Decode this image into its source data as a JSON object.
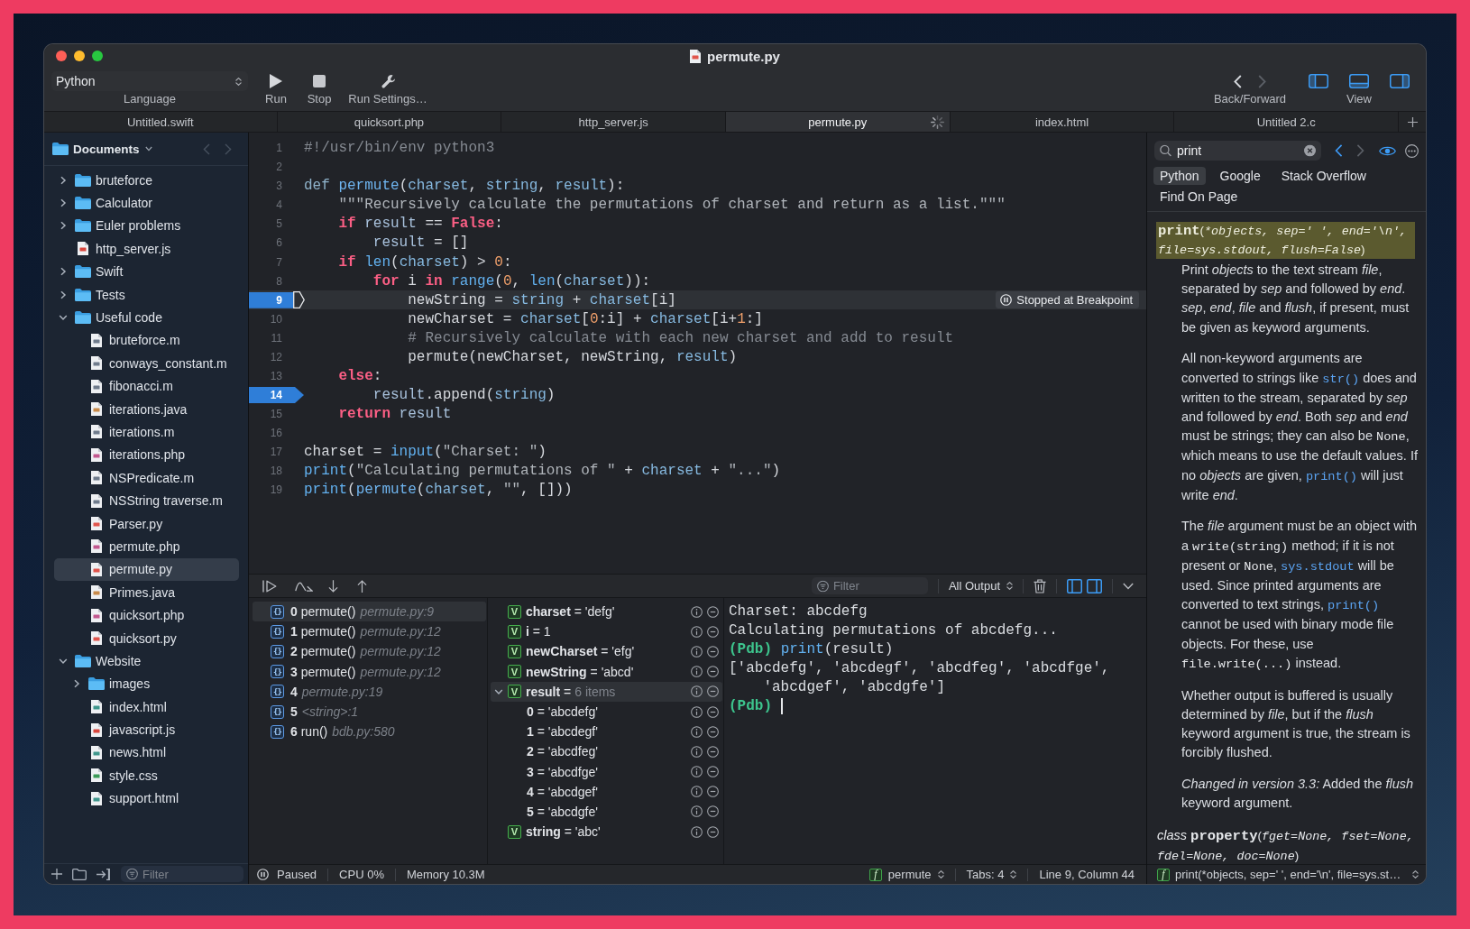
{
  "window": {
    "title": "permute.py",
    "kind": "py"
  },
  "toolbar": {
    "language": {
      "value": "Python",
      "label": "Language"
    },
    "actions": [
      {
        "kind": "run",
        "label": "Run"
      },
      {
        "kind": "stop",
        "label": "Stop"
      },
      {
        "kind": "settings",
        "label": "Run Settings…"
      }
    ],
    "navigation": {
      "label": "Back/Forward",
      "back_enabled": true,
      "forward_enabled": false
    },
    "view": {
      "label": "View",
      "toggles": [
        {
          "on": true
        },
        {
          "on": true
        },
        {
          "on": true
        }
      ]
    }
  },
  "tabs": [
    {
      "label": "Untitled.swift",
      "selected": false,
      "busy": false
    },
    {
      "label": "quicksort.php",
      "selected": false,
      "busy": false
    },
    {
      "label": "http_server.js",
      "selected": false,
      "busy": false
    },
    {
      "label": "permute.py",
      "selected": true,
      "busy": true
    },
    {
      "label": "index.html",
      "selected": false,
      "busy": false
    },
    {
      "label": "Untitled 2.c",
      "selected": false,
      "busy": false
    }
  ],
  "sidebar": {
    "title": "Documents",
    "back_enabled": false,
    "forward_enabled": false,
    "items": [
      {
        "kind": "folder",
        "name": "bruteforce",
        "expanded": false,
        "selected": false
      },
      {
        "kind": "folder",
        "name": "Calculator",
        "expanded": false,
        "selected": false
      },
      {
        "kind": "folder",
        "name": "Euler problems",
        "expanded": false,
        "selected": false
      },
      {
        "kind": "js",
        "name": "http_server.js",
        "selected": false
      },
      {
        "kind": "folder",
        "name": "Swift",
        "expanded": false,
        "selected": false
      },
      {
        "kind": "folder",
        "name": "Tests",
        "expanded": false,
        "selected": false
      },
      {
        "kind": "folder",
        "name": "Useful code",
        "expanded": true,
        "selected": false,
        "children": [
          {
            "kind": "m",
            "name": "bruteforce.m",
            "selected": false
          },
          {
            "kind": "m",
            "name": "conways_constant.m",
            "selected": false
          },
          {
            "kind": "m",
            "name": "fibonacci.m",
            "selected": false
          },
          {
            "kind": "java",
            "name": "iterations.java",
            "selected": false
          },
          {
            "kind": "m",
            "name": "iterations.m",
            "selected": false
          },
          {
            "kind": "php",
            "name": "iterations.php",
            "selected": false
          },
          {
            "kind": "m",
            "name": "NSPredicate.m",
            "selected": false
          },
          {
            "kind": "m",
            "name": "NSString traverse.m",
            "selected": false
          },
          {
            "kind": "py",
            "name": "Parser.py",
            "selected": false
          },
          {
            "kind": "php",
            "name": "permute.php",
            "selected": false
          },
          {
            "kind": "py",
            "name": "permute.py",
            "selected": true
          },
          {
            "kind": "java",
            "name": "Primes.java",
            "selected": false
          },
          {
            "kind": "php",
            "name": "quicksort.php",
            "selected": false
          },
          {
            "kind": "py",
            "name": "quicksort.py",
            "selected": false
          }
        ]
      },
      {
        "kind": "folder",
        "name": "Website",
        "expanded": true,
        "selected": false,
        "children": [
          {
            "kind": "folder",
            "name": "images",
            "expanded": false,
            "selected": false
          },
          {
            "kind": "html",
            "name": "index.html",
            "selected": false
          },
          {
            "kind": "js",
            "name": "javascript.js",
            "selected": false
          },
          {
            "kind": "html",
            "name": "news.html",
            "selected": false
          },
          {
            "kind": "css",
            "name": "style.css",
            "selected": false
          },
          {
            "kind": "html",
            "name": "support.html",
            "selected": false
          }
        ]
      }
    ],
    "filter": {
      "placeholder": "Filter"
    }
  },
  "editor": {
    "lines": [
      {
        "number": "1",
        "breakpoint": false,
        "current": false,
        "tokens": [
          {
            "kind": "comment",
            "text": "#!/usr/bin/env python3"
          }
        ]
      },
      {
        "number": "2",
        "breakpoint": false,
        "current": false
      },
      {
        "number": "3",
        "breakpoint": false,
        "current": false,
        "tokens": [
          {
            "kind": "decl",
            "text": "def "
          },
          {
            "kind": "name",
            "text": "permute"
          },
          {
            "kind": "plain",
            "text": "("
          },
          {
            "kind": "var",
            "text": "charset"
          },
          {
            "kind": "plain",
            "text": ", "
          },
          {
            "kind": "var",
            "text": "string"
          },
          {
            "kind": "plain",
            "text": ", "
          },
          {
            "kind": "var",
            "text": "result"
          },
          {
            "kind": "plain",
            "text": "):"
          }
        ]
      },
      {
        "number": "4",
        "breakpoint": false,
        "current": false,
        "tokens": [
          {
            "kind": "string",
            "text": "    \"\"\"Recursively calculate the permutations of charset and return as a list.\"\"\""
          }
        ]
      },
      {
        "number": "5",
        "breakpoint": false,
        "current": false,
        "tokens": [
          {
            "kind": "keyword",
            "text": "    if"
          },
          {
            "kind": "ident",
            "text": " result"
          },
          {
            "kind": "plain",
            "text": " == "
          },
          {
            "kind": "keyword",
            "text": "False"
          },
          {
            "kind": "plain",
            "text": ":"
          }
        ]
      },
      {
        "number": "6",
        "breakpoint": false,
        "current": false,
        "tokens": [
          {
            "kind": "ident",
            "text": "        result"
          },
          {
            "kind": "plain",
            "text": " = []"
          }
        ]
      },
      {
        "number": "7",
        "breakpoint": false,
        "current": false,
        "tokens": [
          {
            "kind": "keyword",
            "text": "    if "
          },
          {
            "kind": "builtin",
            "text": "len"
          },
          {
            "kind": "plain",
            "text": "("
          },
          {
            "kind": "var",
            "text": "charset"
          },
          {
            "kind": "plain",
            "text": ") > "
          },
          {
            "kind": "number",
            "text": "0"
          },
          {
            "kind": "plain",
            "text": ":"
          }
        ]
      },
      {
        "number": "8",
        "breakpoint": false,
        "current": false,
        "tokens": [
          {
            "kind": "keyword",
            "text": "        for"
          },
          {
            "kind": "plain",
            "text": " i "
          },
          {
            "kind": "keyword",
            "text": "in "
          },
          {
            "kind": "builtin",
            "text": "range"
          },
          {
            "kind": "plain",
            "text": "("
          },
          {
            "kind": "number",
            "text": "0"
          },
          {
            "kind": "plain",
            "text": ", "
          },
          {
            "kind": "builtin",
            "text": "len"
          },
          {
            "kind": "plain",
            "text": "("
          },
          {
            "kind": "var",
            "text": "charset"
          },
          {
            "kind": "plain",
            "text": ")):"
          }
        ]
      },
      {
        "number": "9",
        "breakpoint": true,
        "current": true,
        "badge": "Stopped at Breakpoint",
        "tokens": [
          {
            "kind": "plain",
            "text": "            newString = "
          },
          {
            "kind": "var",
            "text": "string"
          },
          {
            "kind": "plain",
            "text": " + "
          },
          {
            "kind": "var",
            "text": "charset"
          },
          {
            "kind": "plain",
            "text": "[i]"
          }
        ]
      },
      {
        "number": "10",
        "breakpoint": false,
        "current": false,
        "tokens": [
          {
            "kind": "plain",
            "text": "            newCharset = "
          },
          {
            "kind": "var",
            "text": "charset"
          },
          {
            "kind": "plain",
            "text": "["
          },
          {
            "kind": "number",
            "text": "0"
          },
          {
            "kind": "plain",
            "text": ":i] + "
          },
          {
            "kind": "var",
            "text": "charset"
          },
          {
            "kind": "plain",
            "text": "[i+"
          },
          {
            "kind": "number",
            "text": "1"
          },
          {
            "kind": "plain",
            "text": ":]"
          }
        ]
      },
      {
        "number": "11",
        "breakpoint": false,
        "current": false,
        "tokens": [
          {
            "kind": "comment",
            "text": "            # Recursively calculate with each new charset and add to result"
          }
        ]
      },
      {
        "number": "12",
        "breakpoint": false,
        "current": false,
        "tokens": [
          {
            "kind": "plain",
            "text": "            permute(newCharset, newString, "
          },
          {
            "kind": "var",
            "text": "result"
          },
          {
            "kind": "plain",
            "text": ")"
          }
        ]
      },
      {
        "number": "13",
        "breakpoint": false,
        "current": false,
        "tokens": [
          {
            "kind": "keyword",
            "text": "    else"
          },
          {
            "kind": "plain",
            "text": ":"
          }
        ]
      },
      {
        "number": "14",
        "breakpoint": true,
        "current": false,
        "tokens": [
          {
            "kind": "ident",
            "text": "        result"
          },
          {
            "kind": "plain",
            "text": ".append("
          },
          {
            "kind": "var",
            "text": "string"
          },
          {
            "kind": "plain",
            "text": ")"
          }
        ]
      },
      {
        "number": "15",
        "breakpoint": false,
        "current": false,
        "tokens": [
          {
            "kind": "keyword",
            "text": "    return"
          },
          {
            "kind": "ident",
            "text": " result"
          }
        ]
      },
      {
        "number": "16",
        "breakpoint": false,
        "current": false
      },
      {
        "number": "17",
        "breakpoint": false,
        "current": false,
        "tokens": [
          {
            "kind": "plain",
            "text": "charset = "
          },
          {
            "kind": "builtin",
            "text": "input"
          },
          {
            "kind": "plain",
            "text": "("
          },
          {
            "kind": "string",
            "text": "\"Charset: \""
          },
          {
            "kind": "plain",
            "text": ")"
          }
        ]
      },
      {
        "number": "18",
        "breakpoint": false,
        "current": false,
        "tokens": [
          {
            "kind": "builtin",
            "text": "print"
          },
          {
            "kind": "plain",
            "text": "("
          },
          {
            "kind": "string",
            "text": "\"Calculating permutations of \""
          },
          {
            "kind": "plain",
            "text": " + "
          },
          {
            "kind": "var",
            "text": "charset"
          },
          {
            "kind": "plain",
            "text": " + "
          },
          {
            "kind": "string",
            "text": "\"...\""
          },
          {
            "kind": "plain",
            "text": ")"
          }
        ]
      },
      {
        "number": "19",
        "breakpoint": false,
        "current": false,
        "tokens": [
          {
            "kind": "builtin",
            "text": "print"
          },
          {
            "kind": "plain",
            "text": "("
          },
          {
            "kind": "name",
            "text": "permute"
          },
          {
            "kind": "plain",
            "text": "("
          },
          {
            "kind": "var",
            "text": "charset"
          },
          {
            "kind": "plain",
            "text": ", "
          },
          {
            "kind": "string",
            "text": "\"\""
          },
          {
            "kind": "plain",
            "text": ", []))"
          }
        ]
      }
    ]
  },
  "debugger": {
    "filter": {
      "placeholder": "Filter"
    },
    "output_selector": "All Output",
    "pane_toggles": [
      {
        "on": true
      },
      {
        "on": true
      }
    ],
    "stack": [
      {
        "icon": "{}",
        "label": "**0** permute()",
        "location": "permute.py:9",
        "selected": true
      },
      {
        "icon": "{}",
        "label": "**1** permute()",
        "location": "permute.py:12",
        "selected": false
      },
      {
        "icon": "{}",
        "label": "**2** permute()",
        "location": "permute.py:12",
        "selected": false
      },
      {
        "icon": "{}",
        "label": "**3** permute()",
        "location": "permute.py:12",
        "selected": false
      },
      {
        "icon": "{}",
        "label": "**4**",
        "location": "permute.py:19",
        "selected": false
      },
      {
        "icon": "{}",
        "label": "**5**",
        "location": "<string>:1",
        "selected": false
      },
      {
        "icon": "{}",
        "label": "**6** run()",
        "location": "bdb.py:580",
        "selected": false
      }
    ],
    "variables": [
      {
        "icon": "V",
        "label": "**charset** = 'defg'",
        "selected": false
      },
      {
        "icon": "V",
        "label": "**i** = 1",
        "selected": false
      },
      {
        "icon": "V",
        "label": "**newCharset** = 'efg'",
        "selected": false
      },
      {
        "icon": "V",
        "label": "**newString** = 'abcd'",
        "selected": false
      },
      {
        "icon": "V",
        "label": "**result** =",
        "summary": "6 items",
        "expanded": true,
        "selected": true,
        "children": [
          {
            "label": "**0** = 'abcdefg'",
            "selected": false
          },
          {
            "label": "**1** = 'abcdegf'",
            "selected": false
          },
          {
            "label": "**2** = 'abcdfeg'",
            "selected": false
          },
          {
            "label": "**3** = 'abcdfge'",
            "selected": false
          },
          {
            "label": "**4** = 'abcdgef'",
            "selected": false
          },
          {
            "label": "**5** = 'abcdgfe'",
            "selected": false
          }
        ]
      },
      {
        "icon": "V",
        "label": "**string** = 'abc'",
        "selected": false
      }
    ],
    "console": [
      {
        "kind": "output",
        "text": "Charset: abcdefg"
      },
      {
        "kind": "output",
        "text": "Calculating permutations of abcdefg..."
      },
      {
        "kind": "prompt",
        "prompt": "(Pdb)",
        "tokens": [
          {
            "kind": "builtin",
            "text": "print"
          },
          {
            "kind": "plain",
            "text": "(result)"
          }
        ],
        "cursor": false
      },
      {
        "kind": "output",
        "text": "['abcdefg', 'abcdegf', 'abcdfeg', 'abcdfge', 'abcdgef', 'abcdgfe']"
      },
      {
        "kind": "prompt",
        "prompt": "(Pdb)",
        "cursor": true
      }
    ]
  },
  "status_bar": {
    "state": "Paused",
    "cpu": "CPU 0%",
    "memory": "Memory 10.3M",
    "function": {
      "icon": "f",
      "label": "permute"
    },
    "tabs": "Tabs: 4",
    "position": "Line 9, Column 44"
  },
  "docs": {
    "search": {
      "value": "print"
    },
    "back_enabled": true,
    "forward_enabled": false,
    "preview_on": true,
    "sources": [
      {
        "label": "Python",
        "selected": true
      },
      {
        "label": "Google",
        "selected": false
      },
      {
        "label": "Stack Overflow",
        "selected": false
      },
      {
        "label": "Find On Page",
        "selected": false
      }
    ],
    "signature": [
      {
        "kind": "name",
        "text": "print"
      },
      {
        "kind": "punct",
        "text": "("
      },
      {
        "kind": "params",
        "text": "*objects, sep=' ', end='\\n', file=sys.stdout, flush=False"
      },
      {
        "kind": "punct",
        "text": ")"
      }
    ],
    "paragraphs": [
      {
        "parts": [
          {
            "kind": "text",
            "text": "Print *objects* to the text stream *file*, separated by *sep* and followed by *end*. *sep*, *end*, *file* and *flush*, if present, must be given as keyword arguments."
          }
        ]
      },
      {
        "parts": [
          {
            "kind": "text",
            "text": "All non-keyword arguments are converted to strings like "
          },
          {
            "kind": "link",
            "text": "str()"
          },
          {
            "kind": "text",
            "text": " does and written to the stream, separated by *sep* and followed by *end*. Both *sep* and *end* must be strings; they can also be "
          },
          {
            "kind": "code",
            "text": "None"
          },
          {
            "kind": "text",
            "text": ", which means to use the default values. If no *objects* are given, "
          },
          {
            "kind": "link",
            "text": "print()"
          },
          {
            "kind": "text",
            "text": " will just write *end*."
          }
        ]
      },
      {
        "parts": [
          {
            "kind": "text",
            "text": "The *file* argument must be an object with a "
          },
          {
            "kind": "code",
            "text": "write(string)"
          },
          {
            "kind": "text",
            "text": " method; if it is not present or "
          },
          {
            "kind": "code",
            "text": "None"
          },
          {
            "kind": "text",
            "text": ", "
          },
          {
            "kind": "link",
            "text": "sys.stdout"
          },
          {
            "kind": "text",
            "text": " will be used. Since printed arguments are converted to text strings, "
          },
          {
            "kind": "link",
            "text": "print()"
          },
          {
            "kind": "text",
            "text": " cannot be used with binary mode file objects. For these, use "
          },
          {
            "kind": "code",
            "text": "file.write(...)"
          },
          {
            "kind": "text",
            "text": " instead."
          }
        ]
      },
      {
        "parts": [
          {
            "kind": "text",
            "text": "Whether output is buffered is usually determined by *file*, but if the *flush* keyword argument is true, the stream is forcibly flushed."
          }
        ]
      },
      {
        "parts": [
          {
            "kind": "text",
            "text": "*Changed in version 3.3:* Added the *flush* keyword argument."
          }
        ]
      }
    ],
    "class_signature": [
      {
        "kind": "keyword",
        "text": "class "
      },
      {
        "kind": "name",
        "text": "property"
      },
      {
        "kind": "punct",
        "text": "("
      },
      {
        "kind": "params",
        "text": "fget=None, fset=None, fdel=None, doc=None"
      },
      {
        "kind": "punct",
        "text": ")"
      }
    ],
    "footer": {
      "icon": "f",
      "label": "print(*objects, sep=' ', end='\\n', file=sys.st…"
    }
  }
}
